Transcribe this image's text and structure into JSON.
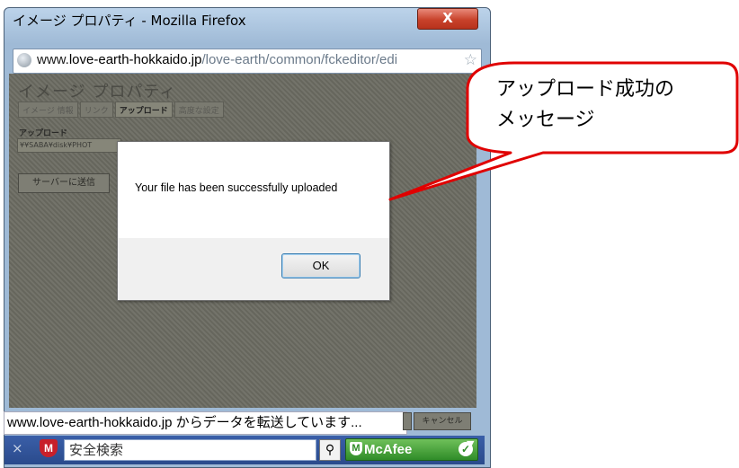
{
  "window": {
    "title": "イメージ プロパティ - Mozilla Firefox",
    "close_label": "X",
    "url_domain_prefix": "www.",
    "url_domain": "love-earth-hokkaido.jp",
    "url_path": "/love-earth/common/fckeditor/edi",
    "status_text": "www.love-earth-hokkaido.jp からデータを転送しています..."
  },
  "dialog": {
    "title": "イメージ プロパティ",
    "tabs": [
      "イメージ 情報",
      "リンク",
      "アップロード",
      "高度な設定"
    ],
    "active_tab": "アップロード",
    "upload_label": "アップロード",
    "file_value": "¥¥SABA¥disk¥PHOT",
    "send_button": "サーバーに送信",
    "cancel_button": "キャンセル"
  },
  "alert": {
    "message": "Your file has been successfully uploaded",
    "ok_label": "OK"
  },
  "toolbar": {
    "close_glyph": "×",
    "mcafee_m": "M",
    "search_placeholder": "安全検索",
    "search_icon": "⚲",
    "brand": "McAfee",
    "check": "✓",
    "dropdown": "▼"
  },
  "callout": {
    "line1": "アップロード成功の",
    "line2": "メッセージ"
  },
  "colors": {
    "callout_border": "#e00000",
    "overlay": "#6c6c62",
    "frame": "#9fbad6"
  }
}
